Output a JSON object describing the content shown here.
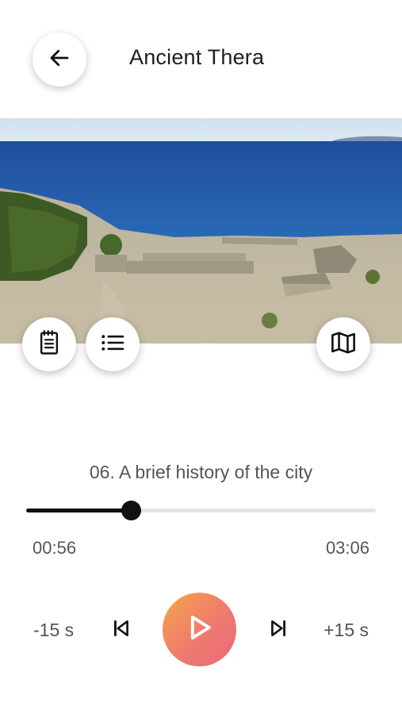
{
  "header": {
    "title": "Ancient Thera",
    "back_icon": "arrow-left-icon"
  },
  "hero": {
    "image_alt": "Ruins of Ancient Thera overlooking the Aegean sea"
  },
  "actions": {
    "notes_icon": "notepad-icon",
    "list_icon": "list-icon",
    "map_icon": "map-icon"
  },
  "player": {
    "track_title": "06. A brief history of the city",
    "elapsed": "00:56",
    "total": "03:06",
    "progress": 0.3,
    "skip_back_label": "-15 s",
    "skip_forward_label": "+15 s",
    "accent_gradient": [
      "#f5a64a",
      "#e86a7c"
    ]
  }
}
